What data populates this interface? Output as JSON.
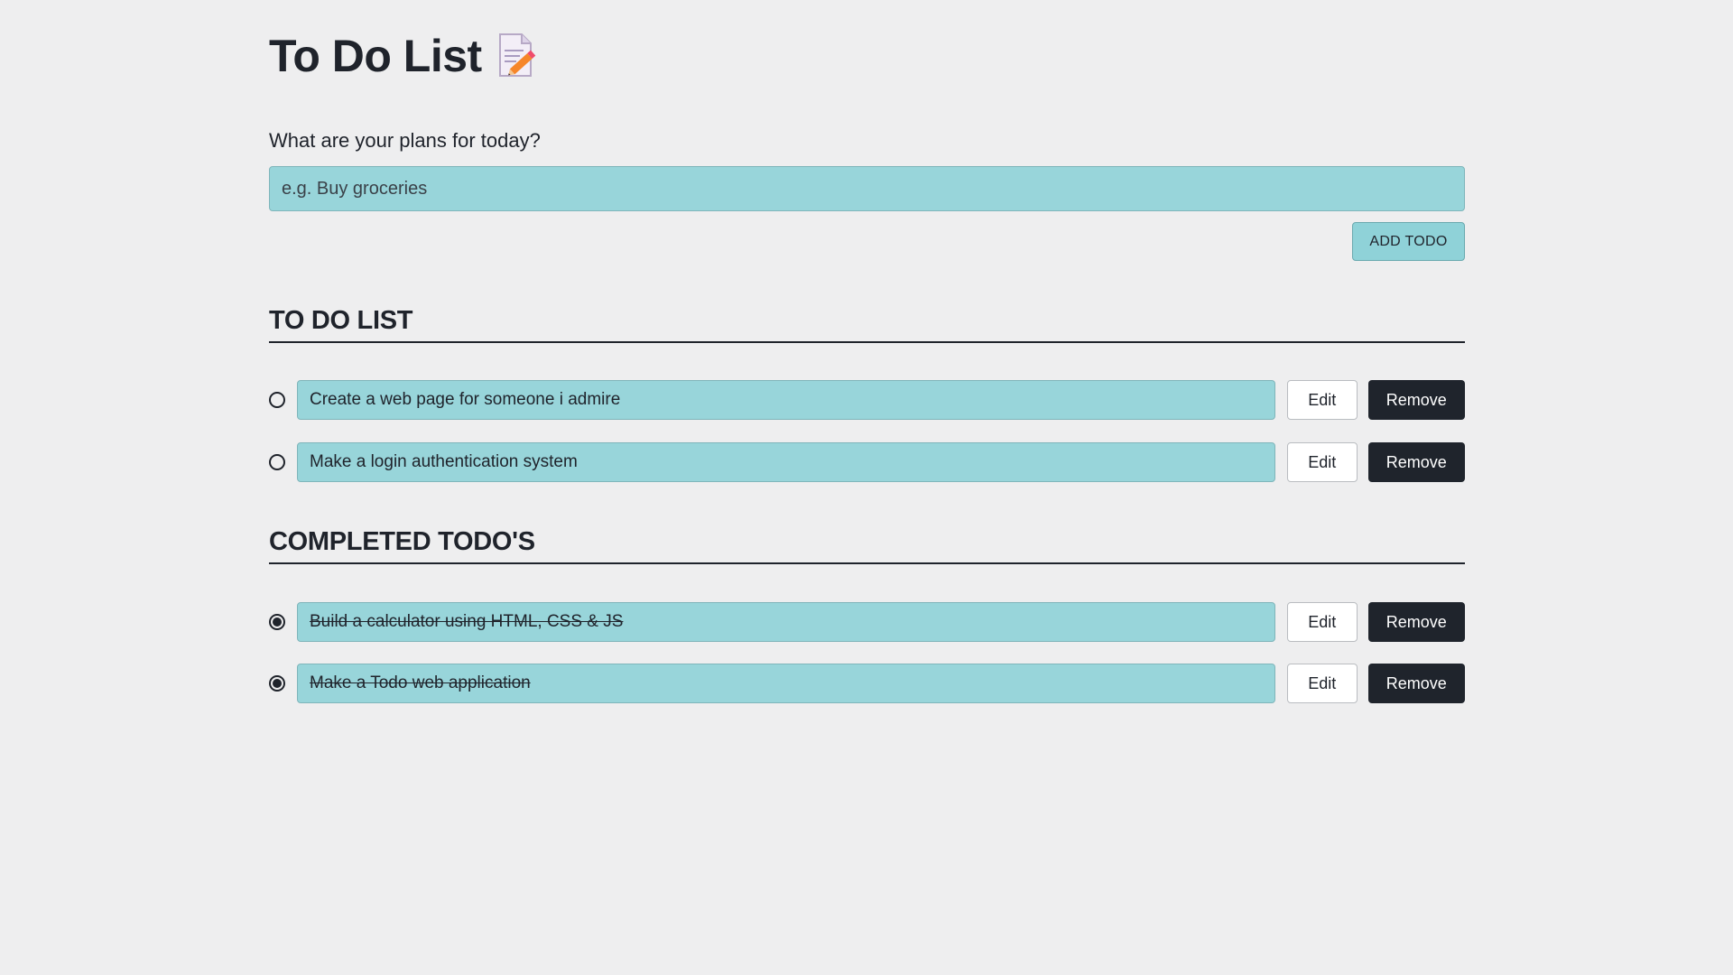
{
  "header": {
    "title": "To Do List",
    "icon": "memo-icon"
  },
  "form": {
    "label": "What are your plans for today?",
    "input_placeholder": "e.g. Buy groceries",
    "input_value": "",
    "add_button_label": "ADD TODO"
  },
  "todo_section": {
    "heading": "TO DO LIST",
    "items": [
      {
        "text": "Create a web page for someone i admire",
        "completed": false,
        "edit_label": "Edit",
        "remove_label": "Remove"
      },
      {
        "text": "Make a login authentication system",
        "completed": false,
        "edit_label": "Edit",
        "remove_label": "Remove"
      }
    ]
  },
  "completed_section": {
    "heading": "COMPLETED TODO'S",
    "items": [
      {
        "text": "Build a calculator using HTML, CSS & JS",
        "completed": true,
        "edit_label": "Edit",
        "remove_label": "Remove"
      },
      {
        "text": "Make a Todo web application",
        "completed": true,
        "edit_label": "Edit",
        "remove_label": "Remove"
      }
    ]
  },
  "colors": {
    "background": "#eeeeef",
    "accent": "#98d5da",
    "dark": "#1f242c"
  }
}
